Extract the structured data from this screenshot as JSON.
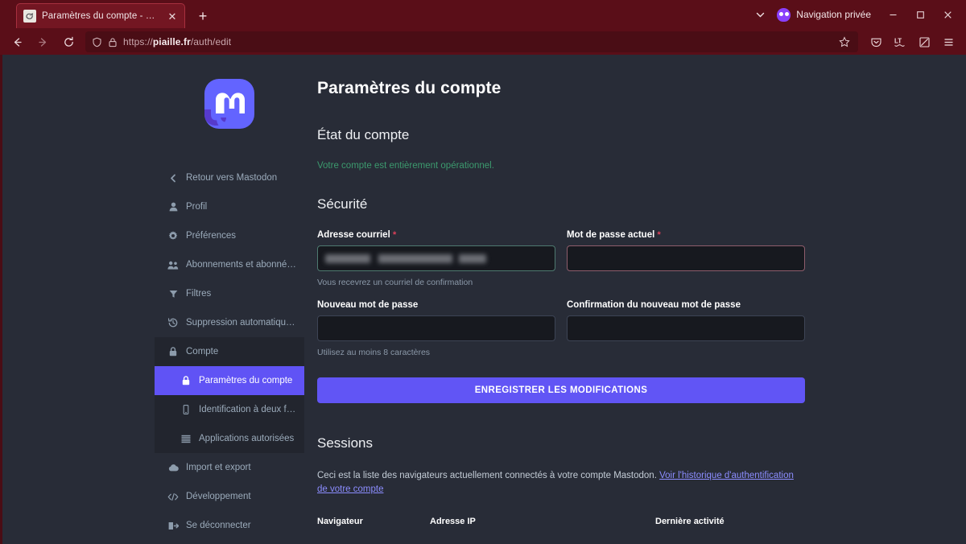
{
  "browser": {
    "tab": {
      "title": "Paramètres du compte - Piaille",
      "favicon_name": "bird-favicon",
      "close_label": "✕"
    },
    "newtab_label": "+",
    "private_mode_label": "Navigation privée",
    "window_controls": {
      "minimize": "—",
      "maximize": "▢",
      "close": "✕"
    },
    "nav": {
      "back_label": "←",
      "forward_label": "→",
      "reload_label": "⟳"
    },
    "url": {
      "scheme": "https://",
      "host": "piaille.fr",
      "path": "/auth/edit",
      "full": "https://piaille.fr/auth/edit"
    },
    "toolbar_icons": [
      "pocket-icon",
      "translate-icon",
      "screenshot-icon",
      "app-menu-icon"
    ]
  },
  "sidebar": {
    "logo_name": "mastodon-logo",
    "items": [
      {
        "label": "Retour vers Mastodon",
        "icon": "chevron-left-icon",
        "level": "top",
        "active": false
      },
      {
        "label": "Profil",
        "icon": "user-icon",
        "level": "top",
        "active": false
      },
      {
        "label": "Préférences",
        "icon": "gear-icon",
        "level": "top",
        "active": false
      },
      {
        "label": "Abonnements et abonné·e·s",
        "icon": "users-icon",
        "level": "top",
        "active": false
      },
      {
        "label": "Filtres",
        "icon": "filter-icon",
        "level": "top",
        "active": false
      },
      {
        "label": "Suppression automatique de ...",
        "icon": "history-icon",
        "level": "top",
        "active": false
      },
      {
        "label": "Compte",
        "icon": "lock-icon",
        "level": "group",
        "active": false
      },
      {
        "label": "Paramètres du compte",
        "icon": "lock-icon",
        "level": "sub",
        "active": true
      },
      {
        "label": "Identification à deux fac...",
        "icon": "mobile-icon",
        "level": "sub",
        "active": false
      },
      {
        "label": "Applications autorisées",
        "icon": "list-icon",
        "level": "sub",
        "active": false
      },
      {
        "label": "Import et export",
        "icon": "cloud-icon",
        "level": "top",
        "active": false
      },
      {
        "label": "Développement",
        "icon": "code-icon",
        "level": "top",
        "active": false
      },
      {
        "label": "Se déconnecter",
        "icon": "logout-icon",
        "level": "top",
        "active": false
      }
    ]
  },
  "main": {
    "page_title": "Paramètres du compte",
    "account_status": {
      "heading": "État du compte",
      "message": "Votre compte est entièrement opérationnel."
    },
    "security": {
      "heading": "Sécurité",
      "email": {
        "label": "Adresse courriel",
        "required_marker": "*",
        "value": "",
        "hint": "Vous recevrez un courriel de confirmation"
      },
      "current_password": {
        "label": "Mot de passe actuel",
        "required_marker": "*",
        "value": ""
      },
      "new_password": {
        "label": "Nouveau mot de passe",
        "value": "",
        "hint": "Utilisez au moins 8 caractères"
      },
      "confirm_password": {
        "label": "Confirmation du nouveau mot de passe",
        "value": ""
      },
      "submit_label": "ENREGISTRER LES MODIFICATIONS"
    },
    "sessions": {
      "heading": "Sessions",
      "description": "Ceci est la liste des navigateurs actuellement connectés à votre compte Mastodon. ",
      "link_text": "Voir l'historique d'authentification de votre compte",
      "columns": [
        "Navigateur",
        "Adresse IP",
        "Dernière activité"
      ]
    }
  },
  "colors": {
    "chrome": "#5a0e18",
    "page_bg": "#282c37",
    "accent": "#6155f5",
    "success": "#3c9a6e",
    "required": "#df405a",
    "link": "#8c8dff"
  }
}
